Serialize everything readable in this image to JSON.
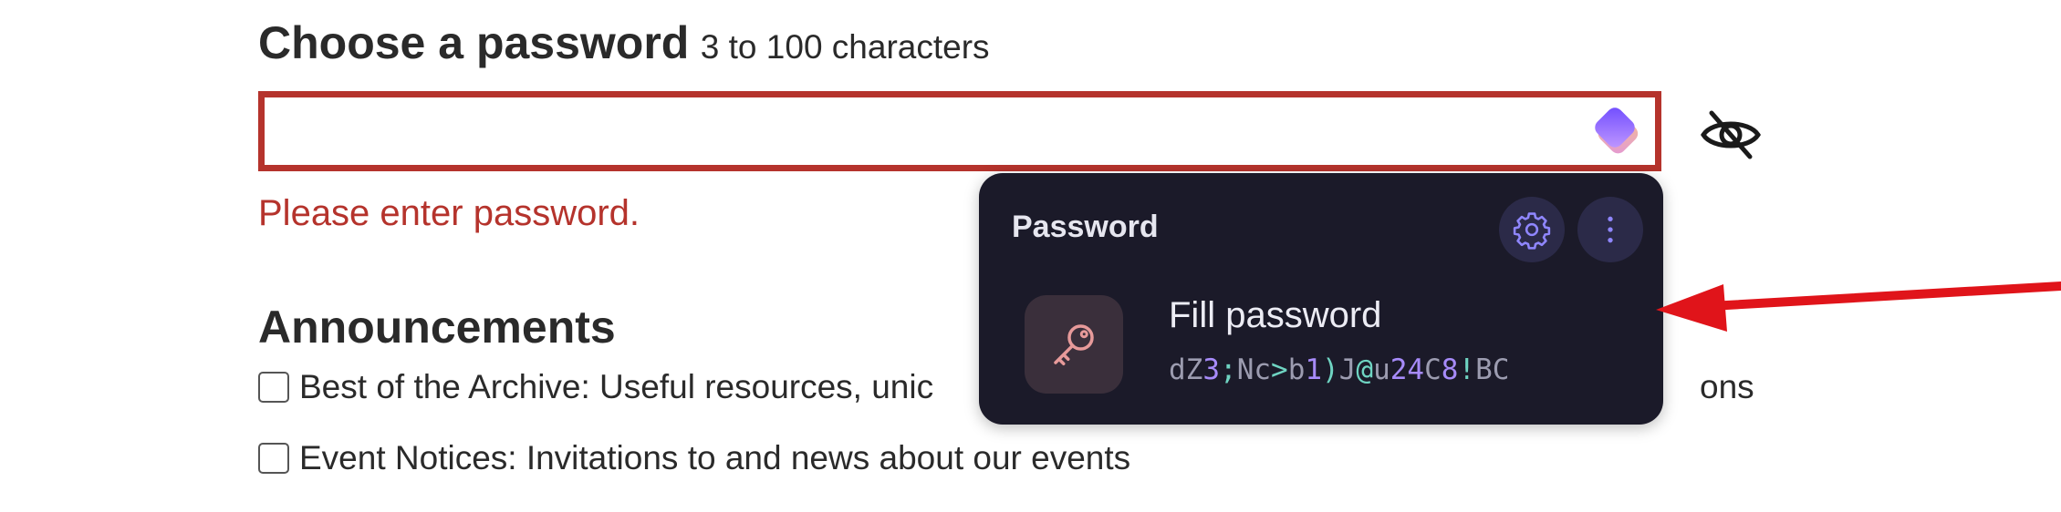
{
  "form": {
    "password_label": "Choose a password",
    "password_hint": "3 to 100 characters",
    "password_value": "",
    "error_message": "Please enter password."
  },
  "announcements": {
    "title": "Announcements",
    "items": [
      {
        "label": "Best of the Archive: Useful resources, unic",
        "label_tail": "ons",
        "checked": false
      },
      {
        "label": "Event Notices: Invitations to and news about our events",
        "checked": false
      }
    ]
  },
  "popup": {
    "title": "Password",
    "fill_label": "Fill password",
    "generated_password": "dZ3;Nc>b1)J@u24C8!BC",
    "icons": {
      "settings": "gear-icon",
      "more": "more-vertical-icon",
      "item": "key-icon"
    }
  },
  "colors": {
    "error": "#b5332c",
    "popup_bg": "#1b1a29",
    "popup_button_bg": "#2b2a48",
    "accent_purple": "#a78bfa",
    "arrow": "#e0141a"
  }
}
